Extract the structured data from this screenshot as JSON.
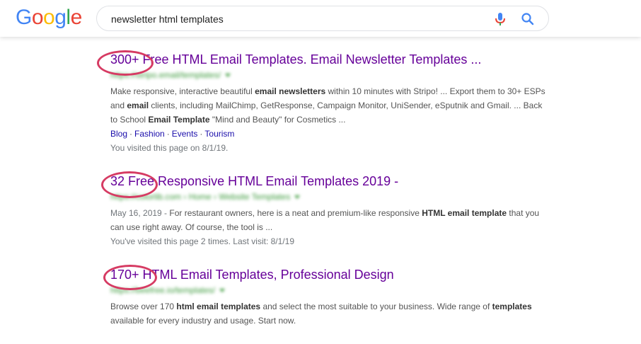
{
  "header": {
    "logo": [
      {
        "letter": "G",
        "color": "#4285F4"
      },
      {
        "letter": "o",
        "color": "#EA4335"
      },
      {
        "letter": "o",
        "color": "#FBBC05"
      },
      {
        "letter": "g",
        "color": "#4285F4"
      },
      {
        "letter": "l",
        "color": "#34A853"
      },
      {
        "letter": "e",
        "color": "#EA4335"
      }
    ],
    "search_value": "newsletter html templates",
    "mic_icon": "microphone-icon",
    "search_icon": "magnifier-icon"
  },
  "results": [
    {
      "title": "300+ Free HTML Email Templates. Email Newsletter Templates ...",
      "url": "https://stripo.email/templates/",
      "snippet_parts": [
        {
          "t": "Make responsive, interactive beautiful "
        },
        {
          "t": "email newsletters",
          "b": true
        },
        {
          "t": " within 10 minutes with Stripo! ... Export them to 30+ ESPs and "
        },
        {
          "t": "email",
          "b": true
        },
        {
          "t": " clients, including MailChimp, GetResponse, Campaign Monitor, UniSender, eSputnik and Gmail. ... Back to School "
        },
        {
          "t": "Email Template",
          "b": true
        },
        {
          "t": " \"Mind and Beauty\" for Cosmetics ..."
        }
      ],
      "sitelinks": [
        "Blog",
        "Fashion",
        "Events",
        "Tourism"
      ],
      "visited": "You visited this page on 8/1/19."
    },
    {
      "title": "32 Free Responsive HTML Email Templates 2019 -",
      "url": "https://colorlib.com › Home › Website Templates",
      "date": "May 16, 2019 - ",
      "snippet_parts": [
        {
          "t": "For restaurant owners, here is a neat and premium-like responsive "
        },
        {
          "t": "HTML email template",
          "b": true
        },
        {
          "t": " that you can use right away. Of course, the tool is ..."
        }
      ],
      "visited": "You've visited this page 2 times. Last visit: 8/1/19"
    },
    {
      "title": "170+ HTML Email Templates, Professional Design",
      "url": "https://beefree.io/templates/",
      "snippet_parts": [
        {
          "t": "Browse over 170 "
        },
        {
          "t": "html email templates",
          "b": true
        },
        {
          "t": " and select the most suitable to your business. Wide range of "
        },
        {
          "t": "templates",
          "b": true
        },
        {
          "t": " available for every industry and usage. Start now."
        }
      ]
    }
  ],
  "annotation_color": "#d63b63"
}
